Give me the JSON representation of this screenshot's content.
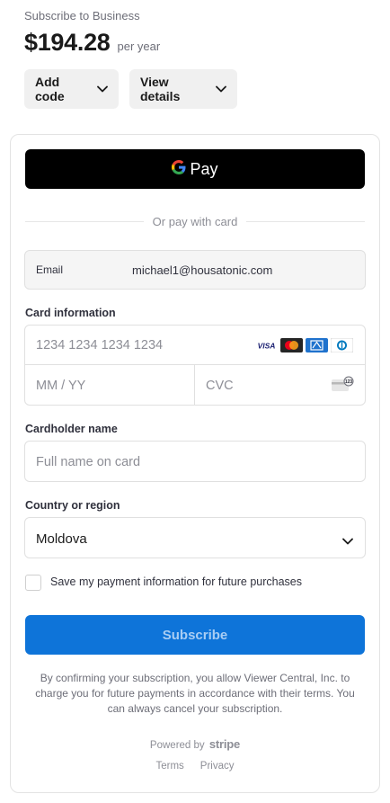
{
  "header": {
    "subtitle": "Subscribe to Business",
    "price": "$194.28",
    "period": "per year"
  },
  "actions": {
    "add_code": "Add code",
    "view_details": "View details"
  },
  "gpay": {
    "label": "Pay"
  },
  "divider": {
    "text": "Or pay with card"
  },
  "email": {
    "label": "Email",
    "value": "michael1@housatonic.com"
  },
  "card_info": {
    "label": "Card information",
    "number_placeholder": "1234 1234 1234 1234",
    "expiry_placeholder": "MM / YY",
    "cvc_placeholder": "CVC",
    "brands": [
      "visa-icon",
      "mastercard-icon",
      "amex-icon",
      "diners-icon"
    ]
  },
  "cardholder": {
    "label": "Cardholder name",
    "placeholder": "Full name on card"
  },
  "country": {
    "label": "Country or region",
    "value": "Moldova"
  },
  "save_info": {
    "label": "Save my payment information for future purchases",
    "checked": false
  },
  "subscribe": {
    "label": "Subscribe",
    "color": "#0e74d9"
  },
  "legal": {
    "text": "By confirming your subscription, you allow Viewer Central, Inc. to charge you for future payments in accordance with their terms. You can always cancel your subscription."
  },
  "footer": {
    "powered_by": "Powered by",
    "brand": "stripe",
    "terms": "Terms",
    "privacy": "Privacy"
  }
}
